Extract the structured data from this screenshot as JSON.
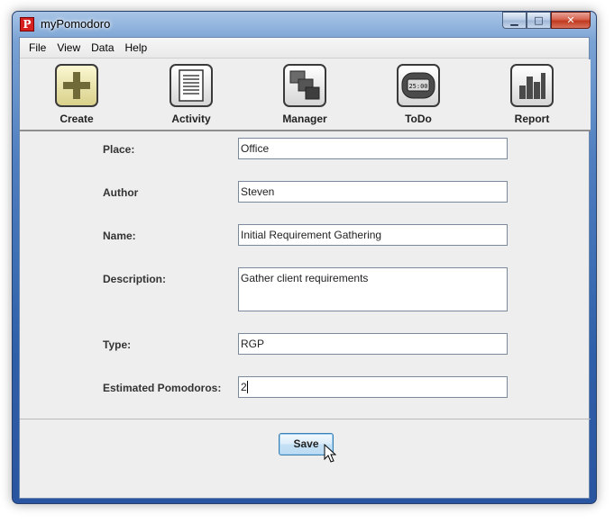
{
  "window": {
    "title": "myPomodoro",
    "app_icon_letter": "P",
    "controls": {
      "minimize": "▁",
      "maximize": "□",
      "close": "✕"
    }
  },
  "menubar": {
    "items": [
      {
        "label": "File"
      },
      {
        "label": "View"
      },
      {
        "label": "Data"
      },
      {
        "label": "Help"
      }
    ]
  },
  "toolbar": {
    "buttons": [
      {
        "label": "Create",
        "icon": "plus-icon"
      },
      {
        "label": "Activity",
        "icon": "document-list-icon"
      },
      {
        "label": "Manager",
        "icon": "stacked-windows-icon"
      },
      {
        "label": "ToDo",
        "icon": "timer-icon",
        "icon_text": "25:00"
      },
      {
        "label": "Report",
        "icon": "bar-chart-icon"
      }
    ]
  },
  "form": {
    "place": {
      "label": "Place:",
      "value": "Office"
    },
    "author": {
      "label": "Author",
      "value": "Steven"
    },
    "name": {
      "label": "Name:",
      "value": "Initial Requirement Gathering"
    },
    "description": {
      "label": "Description:",
      "value": "Gather client requirements"
    },
    "type": {
      "label": "Type:",
      "value": "RGP"
    },
    "estimated_pomodoros": {
      "label": "Estimated Pomodoros:",
      "value": "2"
    }
  },
  "actions": {
    "save_label": "Save"
  },
  "colors": {
    "window_frame": "#2f5fa8",
    "client_bg": "#eeeeee",
    "close_button": "#c0391f",
    "create_icon": "#c9c27a"
  }
}
